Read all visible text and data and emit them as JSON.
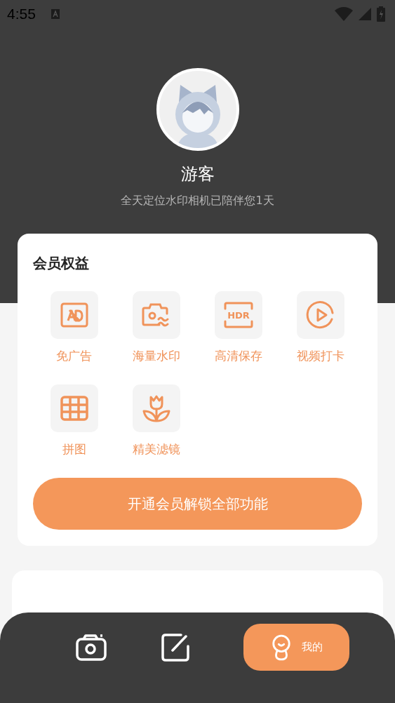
{
  "status_bar": {
    "time": "4:55"
  },
  "profile": {
    "name": "游客",
    "subtitle": "全天定位水印相机已陪伴您1天"
  },
  "membership": {
    "title": "会员权益",
    "benefits": [
      {
        "kind": "no-ads",
        "label": "免广告"
      },
      {
        "kind": "watermark",
        "label": "海量水印"
      },
      {
        "kind": "hdr",
        "icon_text": "HDR",
        "label": "高清保存"
      },
      {
        "kind": "video",
        "label": "视频打卡"
      },
      {
        "kind": "collage",
        "label": "拼图"
      },
      {
        "kind": "filter",
        "label": "精美滤镜"
      }
    ],
    "button": "开通会员解锁全部功能"
  },
  "bottom_nav": [
    {
      "kind": "camera",
      "selected": false
    },
    {
      "kind": "edit",
      "selected": false
    },
    {
      "kind": "profile",
      "label": "我的",
      "selected": true
    }
  ]
}
